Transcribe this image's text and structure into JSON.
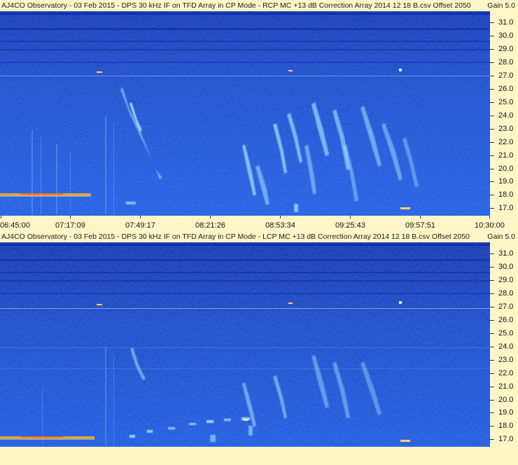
{
  "top_panel": {
    "title": "AJ4CO Observatory - 03 Feb 2015 - DPS 30 kHz IF on TFD Array in CP Mode - RCP  MC +13 dB  Correction Array 2014 12 18 B.csv  Offset 2050",
    "gain": "Gain 5.0",
    "y_labels": [
      "31.0",
      "30.0",
      "29.0",
      "28.0",
      "27.0",
      "26.0",
      "25.0",
      "24.0",
      "23.0",
      "22.0",
      "21.0",
      "20.0",
      "19.0",
      "18.0",
      "17.0"
    ],
    "x_labels": [
      "06:45:00",
      "07:17:09",
      "07:49:17",
      "08:21:26",
      "08:53:34",
      "09:25:43",
      "09:57:51",
      "10:30:00"
    ]
  },
  "bottom_panel": {
    "title": "AJ4CO Observatory - 03 Feb 2015 - DPS 30 kHz IF on TFD Array in CP Mode - LCP  MC +13 dB  Correction Array 2014 12 18 B.csv  Offset 2050",
    "gain": "Gain 5.0",
    "y_labels": [
      "31.0",
      "30.0",
      "29.0",
      "28.0",
      "27.0",
      "26.0",
      "25.0",
      "24.0",
      "23.0",
      "22.0",
      "21.0",
      "20.0",
      "19.0",
      "18.0",
      "17.0"
    ]
  },
  "colors": {
    "background": "#fff6c8",
    "spectrogram_base": "#1648d6",
    "emission": "#9fe0ff",
    "interference": "#ffb020"
  }
}
